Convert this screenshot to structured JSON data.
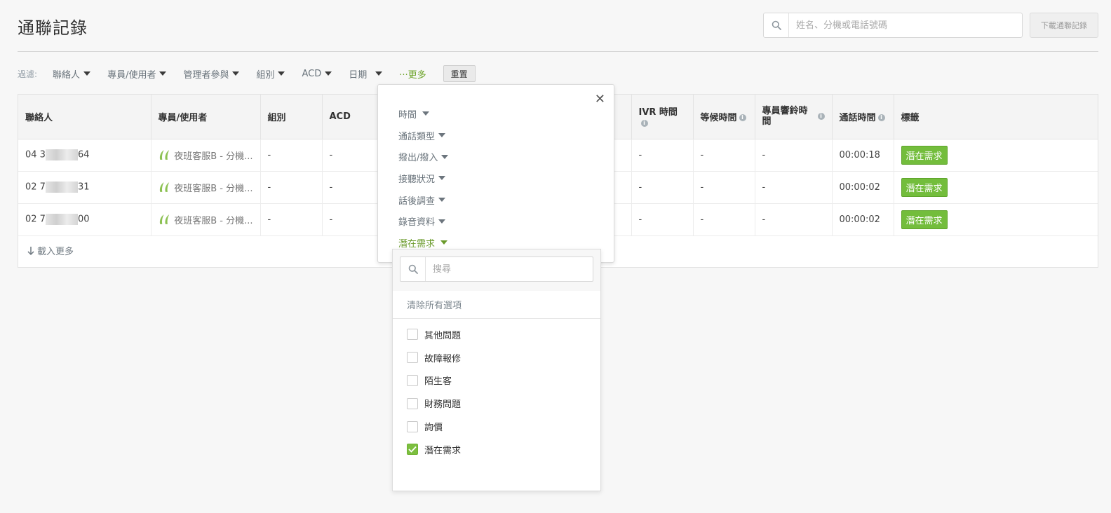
{
  "header": {
    "title": "通聯記錄",
    "search_placeholder": "姓名、分機或電話號碼",
    "download_label": "下載通聯記錄"
  },
  "filters": {
    "label": "過濾:",
    "items": [
      "聯絡人",
      "專員/使用者",
      "管理者參與",
      "組別",
      "ACD",
      "日期"
    ],
    "more_label": "···更多",
    "reset_label": "重置"
  },
  "table": {
    "columns": [
      "聯絡人",
      "專員/使用者",
      "組別",
      "ACD",
      "IVR 時間",
      "等候時間",
      "專員響鈴時間",
      "通話時間",
      "標籤"
    ],
    "rows": [
      {
        "contact_prefix": "04 3",
        "contact_suffix": "64",
        "agent": "夜班客服B - 分機...",
        "group": "-",
        "acd": "-",
        "ivr": "-",
        "wait": "-",
        "ring": "-",
        "talk": "00:00:18",
        "tag": "潛在需求"
      },
      {
        "contact_prefix": "02 7",
        "contact_suffix": "31",
        "agent": "夜班客服B - 分機...",
        "group": "-",
        "acd": "-",
        "ivr": "-",
        "wait": "-",
        "ring": "-",
        "talk": "00:00:02",
        "tag": "潛在需求"
      },
      {
        "contact_prefix": "02 7",
        "contact_suffix": "00",
        "agent": "夜班客服B - 分機...",
        "group": "-",
        "acd": "-",
        "ivr": "-",
        "wait": "-",
        "ring": "-",
        "talk": "00:00:02",
        "tag": "潛在需求"
      }
    ],
    "load_more": "載入更多"
  },
  "more_popup": {
    "items": [
      "時間",
      "通話類型",
      "撥出/撥入",
      "接聽狀況",
      "話後調查",
      "錄音資料",
      "潛在需求"
    ],
    "active_item": "潛在需求"
  },
  "tag_dropdown": {
    "search_placeholder": "搜尋",
    "clear_label": "清除所有選項",
    "options": [
      {
        "label": "其他問題",
        "checked": false
      },
      {
        "label": "故障報修",
        "checked": false
      },
      {
        "label": "陌生客",
        "checked": false
      },
      {
        "label": "財務問題",
        "checked": false
      },
      {
        "label": "詢價",
        "checked": false
      },
      {
        "label": "潛在需求",
        "checked": true
      }
    ]
  },
  "colors": {
    "accent_green": "#73bd3c",
    "link_green": "#6fa52c",
    "muted_text": "#69737b"
  }
}
